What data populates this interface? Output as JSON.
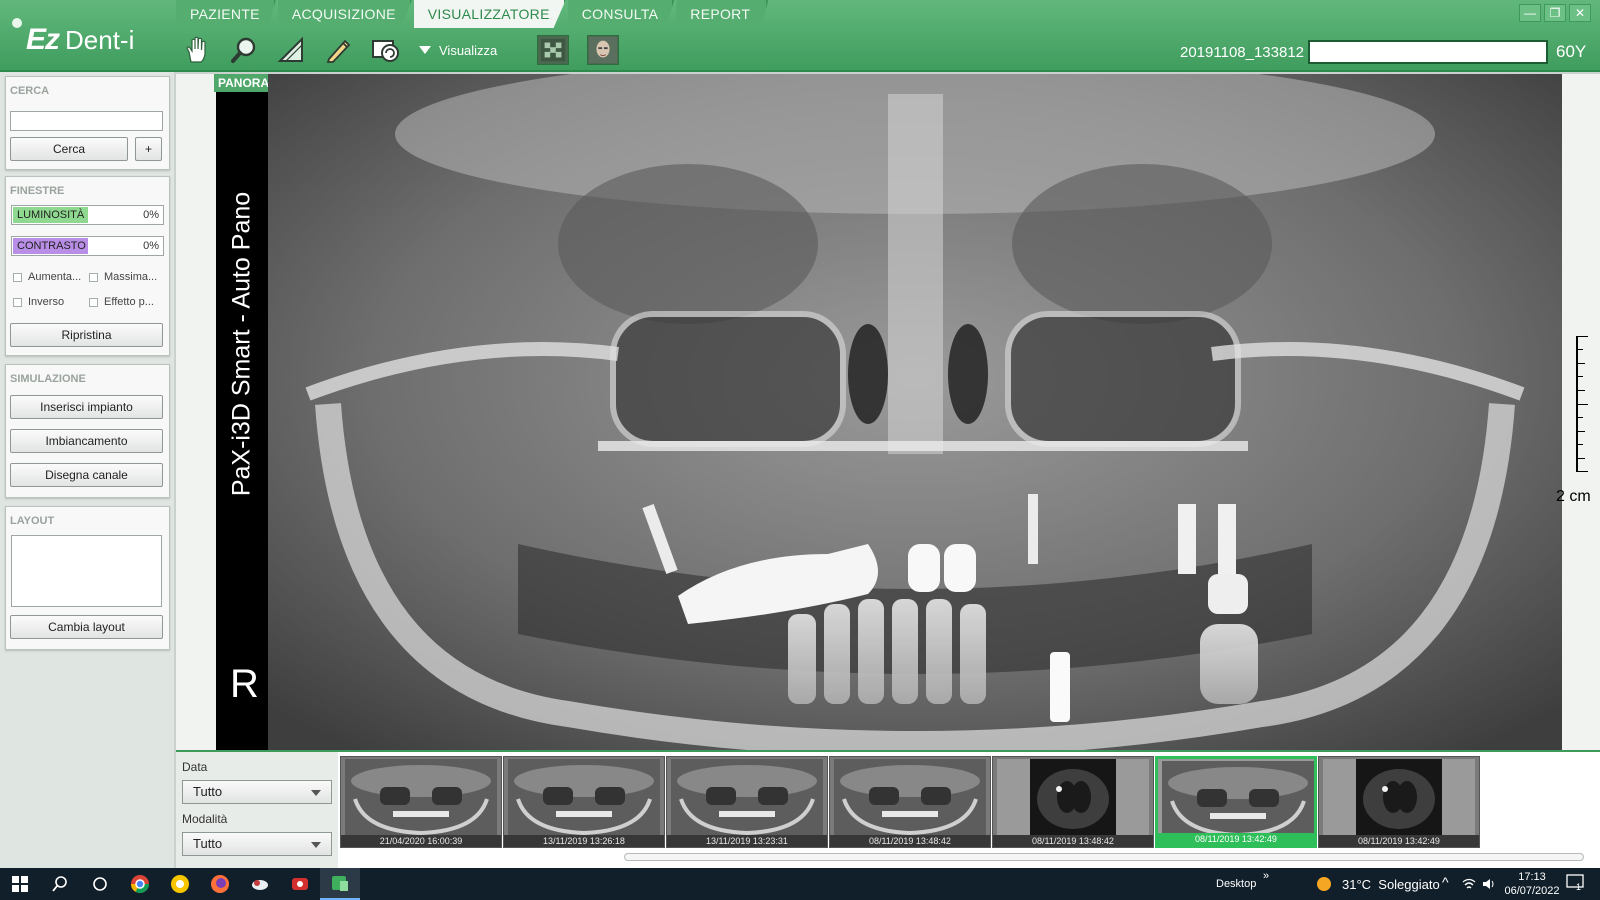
{
  "app": {
    "logo_main": "Ez",
    "logo_sub": "Dent-i"
  },
  "tabs": [
    "PAZIENTE",
    "ACQUISIZIONE",
    "VISUALIZZATORE",
    "CONSULTA",
    "REPORT"
  ],
  "toolbar": {
    "visualizza_label": "Visualizza"
  },
  "patient": {
    "id": "20191108_133812",
    "age": "60Y"
  },
  "window_controls": [
    "—",
    "❐",
    "✕"
  ],
  "search": {
    "title": "CERCA",
    "value": "",
    "button": "Cerca",
    "plus": "+"
  },
  "windows": {
    "title": "FINESTRE",
    "brightness": {
      "label": "LUMINOSITÀ",
      "value": "0%",
      "color": "#8fd88f"
    },
    "contrast": {
      "label": "CONTRASTO",
      "value": "0%",
      "color": "#b98ee6"
    },
    "checks": [
      "Aumenta...",
      "Massima...",
      "Inverso",
      "Effetto p..."
    ],
    "reset": "Ripristina"
  },
  "simulation": {
    "title": "SIMULAZIONE",
    "buttons": [
      "Inserisci impianto",
      "Imbiancamento",
      "Disegna canale"
    ]
  },
  "layout": {
    "title": "LAYOUT",
    "button": "Cambia layout"
  },
  "viewer": {
    "tab": "PANORAMICA",
    "device_label": "PaX-i3D Smart - Auto Pano",
    "side_mark": "R",
    "scale": "2 cm"
  },
  "filters": {
    "date_label": "Data",
    "date_value": "Tutto",
    "mode_label": "Modalità",
    "mode_value": "Tutto"
  },
  "thumbnails": [
    {
      "date": "21/04/2020 16:00:39",
      "kind": "pano"
    },
    {
      "date": "13/11/2019 13:26:18",
      "kind": "pano"
    },
    {
      "date": "13/11/2019 13:23:31",
      "kind": "pano"
    },
    {
      "date": "08/11/2019 13:48:42",
      "kind": "pano"
    },
    {
      "date": "08/11/2019 13:48:42",
      "kind": "ct"
    },
    {
      "date": "08/11/2019 13:42:49",
      "kind": "pano",
      "selected": true
    },
    {
      "date": "08/11/2019 13:42:49",
      "kind": "ct"
    }
  ],
  "taskbar": {
    "desktop": "Desktop",
    "weather": "31°C  Soleggiato",
    "time": "17:13",
    "date": "06/07/2022",
    "notif": "1"
  }
}
